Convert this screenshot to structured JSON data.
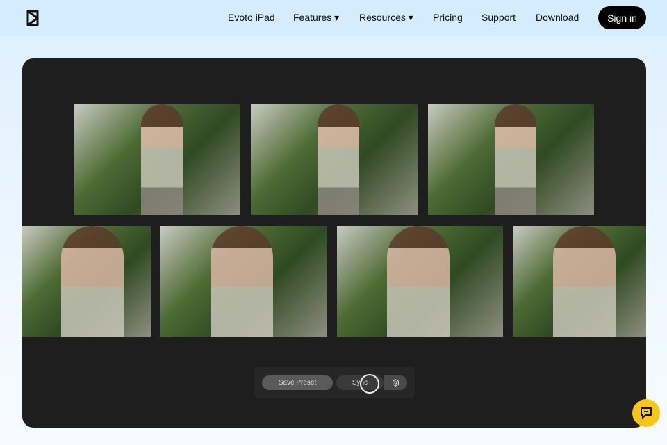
{
  "header": {
    "logo": "evoto-logo",
    "nav": [
      {
        "label": "Evoto iPad"
      },
      {
        "label": "Features ▾"
      },
      {
        "label": "Resources ▾"
      },
      {
        "label": "Pricing"
      },
      {
        "label": "Support"
      },
      {
        "label": "Download"
      }
    ],
    "sign_in": "Sign in"
  },
  "demo": {
    "toolbar": {
      "save_preset": "Save Preset",
      "sync": "Sync",
      "settings_icon": "gear-icon"
    }
  },
  "chat": {
    "icon": "chat-bubble-icon",
    "color": "#f8c51c"
  }
}
